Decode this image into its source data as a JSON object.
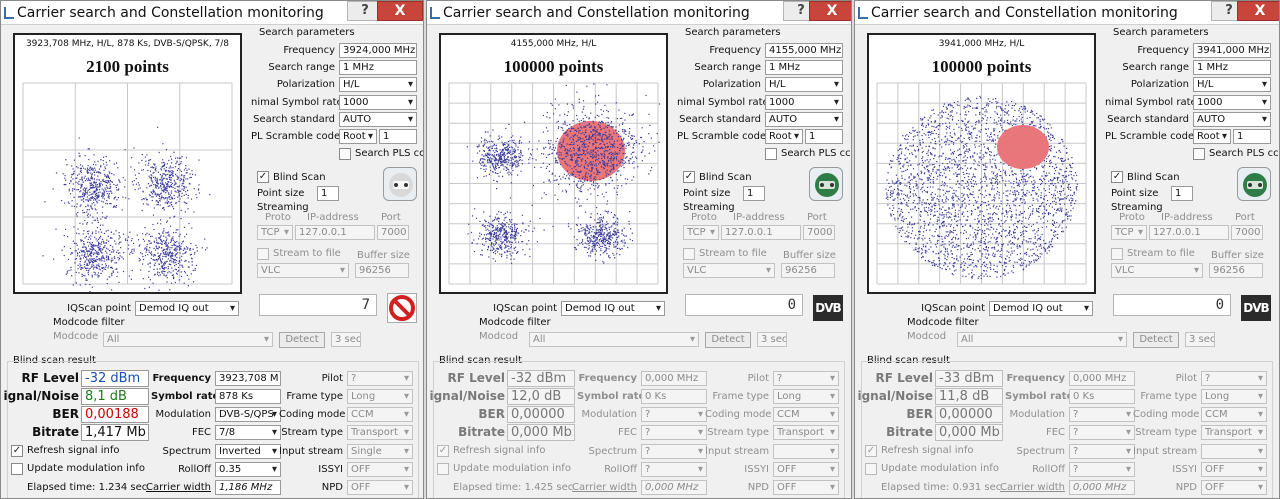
{
  "windows": [
    {
      "title": "Carrier search and Constellation monitoring",
      "help_label": "?",
      "close_label": "X",
      "constellation": {
        "header": "3923,708 MHz, H/L, 878 Ks, DVB-S/QPSK, 7/8",
        "points_text": "2100 points",
        "mode": "qpsk_sparse"
      },
      "search_params": {
        "title": "Search parameters",
        "frequency_label": "Frequency",
        "frequency": "3924,000 MHz",
        "search_range_label": "Search range",
        "search_range": "1 MHz",
        "polarization_label": "Polarization",
        "polarization": "H/L",
        "min_symbol_rate_label": "nimal Symbol rate",
        "min_symbol_rate": "1000",
        "search_standard_label": "Search standard",
        "search_standard": "AUTO",
        "pl_scramble_label": "PL Scramble code",
        "pl_scramble_mode": "Root",
        "pl_scramble_value": "1",
        "search_pls_label": "Search PLS cc"
      },
      "blind_scan_label": "Blind Scan",
      "point_size_label": "Point size",
      "point_size": "1",
      "streaming": {
        "title": "Streaming",
        "proto_label": "Proto",
        "ip_label": "IP-address",
        "port_label": "Port",
        "proto": "TCP",
        "ip": "127.0.0.1",
        "port": "7000",
        "stream_to_file_label": "Stream to file",
        "buffer_size_label": "Buffer size",
        "player": "VLC",
        "buffer_size": "96256"
      },
      "iqscan_label": "IQScan point",
      "iqscan": "Demod IQ out",
      "modcode_filter_label": "Modcode filter",
      "modcode_label": "Modcode",
      "modcode": "All",
      "detect_label": "Detect",
      "detect_time": "3 sec",
      "lcd_value": "7",
      "right_icon": "no-entry-icon",
      "result": {
        "title": "Blind scan result",
        "rf_level_label": "RF Level",
        "rf_level": "-32 dBm",
        "snr_label": "ignal/Noise",
        "snr": "8,1 dB",
        "ber_label": "BER",
        "ber": "0,00188",
        "bitrate_label": "Bitrate",
        "bitrate": "1,417 Mb",
        "refresh_label": "Refresh signal info",
        "update_mod_label": "Update modulation info",
        "elapsed": "Elapsed time: 1.234 sec",
        "frequency_label": "Frequency",
        "frequency": "3923,708 M",
        "symbol_rate_label": "Symbol rate",
        "symbol_rate": "878 Ks",
        "modulation_label": "Modulation",
        "modulation": "DVB-S/QPS",
        "fec_label": "FEC",
        "fec": "7/8",
        "spectrum_label": "Spectrum",
        "spectrum": "Inverted",
        "rolloff_label": "RollOff",
        "rolloff": "0.35",
        "carrier_width_label": "Carrier width",
        "carrier_width": "1,186 MHz",
        "pilot_label": "Pilot",
        "pilot": "?",
        "frame_type_label": "Frame type",
        "frame_type": "Long",
        "coding_mode_label": "Coding mode",
        "coding_mode": "CCM",
        "stream_type_label": "Stream type",
        "stream_type": "Transport",
        "input_stream_label": "Input stream",
        "input_stream": "Single",
        "issyi_label": "ISSYI",
        "issyi": "OFF",
        "npd_label": "NPD",
        "npd": "OFF"
      }
    },
    {
      "title": "Carrier search and Constellation monitoring",
      "help_label": "?",
      "close_label": "X",
      "constellation": {
        "header": "4155,000 MHz, H/L",
        "points_text": "100000 points",
        "mode": "hot_top_right"
      },
      "search_params": {
        "title": "Search parameters",
        "frequency_label": "Frequency",
        "frequency": "4155,000 MHz",
        "search_range_label": "Search range",
        "search_range": "1 MHz",
        "polarization_label": "Polarization",
        "polarization": "H/L",
        "min_symbol_rate_label": "nimal Symbol rate",
        "min_symbol_rate": "1000",
        "search_standard_label": "Search standard",
        "search_standard": "AUTO",
        "pl_scramble_label": "PL Scramble code",
        "pl_scramble_mode": "Root",
        "pl_scramble_value": "1",
        "search_pls_label": "Search PLS cc"
      },
      "blind_scan_label": "Blind Scan",
      "point_size_label": "Point size",
      "point_size": "1",
      "streaming": {
        "title": "Streaming",
        "proto_label": "Proto",
        "ip_label": "IP-address",
        "port_label": "Port",
        "proto": "TCP",
        "ip": "127.0.0.1",
        "port": "7000",
        "stream_to_file_label": "Stream to file",
        "buffer_size_label": "Buffer size",
        "player": "VLC",
        "buffer_size": "96256"
      },
      "iqscan_label": "IQScan point",
      "iqscan": "Demod IQ out",
      "modcode_filter_label": "Modcode filter",
      "modcode_label": "Modcod",
      "modcode": "All",
      "detect_label": "Detect",
      "detect_time": "3 sec",
      "lcd_value": "0",
      "right_icon": "dvb-logo-icon",
      "dvb_text": "DVB",
      "result": {
        "title": "Blind scan result",
        "rf_level_label": "RF Level",
        "rf_level": "-32 dBm",
        "snr_label": "ignal/Noise",
        "snr": "12,0 dB",
        "ber_label": "BER",
        "ber": "0,00000",
        "bitrate_label": "Bitrate",
        "bitrate": "0,000 Mb",
        "refresh_label": "Refresh signal info",
        "update_mod_label": "Update modulation info",
        "elapsed": "Elapsed time: 1.425 sec",
        "frequency_label": "Frequency",
        "frequency": "0,000 MHz",
        "symbol_rate_label": "Symbol rate",
        "symbol_rate": "0 Ks",
        "modulation_label": "Modulation",
        "modulation": "?",
        "fec_label": "FEC",
        "fec": "?",
        "spectrum_label": "Spectrum",
        "spectrum": "?",
        "rolloff_label": "RollOff",
        "rolloff": "?",
        "carrier_width_label": "Carrier width",
        "carrier_width": "0,000 MHz",
        "pilot_label": "Pilot",
        "pilot": "?",
        "frame_type_label": "Frame type",
        "frame_type": "Long",
        "coding_mode_label": "Coding mode",
        "coding_mode": "CCM",
        "stream_type_label": "Stream type",
        "stream_type": "Transport",
        "input_stream_label": "Input stream",
        "input_stream": "",
        "issyi_label": "ISSYI",
        "issyi": "OFF",
        "npd_label": "NPD",
        "npd": "OFF"
      }
    },
    {
      "title": "Carrier search and Constellation monitoring",
      "help_label": "?",
      "close_label": "X",
      "constellation": {
        "header": "3941,000 MHz, H/L",
        "points_text": "100000 points",
        "mode": "blob"
      },
      "search_params": {
        "title": "Search parameters",
        "frequency_label": "Frequency",
        "frequency": "3941,000 MHz",
        "search_range_label": "Search range",
        "search_range": "1 MHz",
        "polarization_label": "Polarization",
        "polarization": "H/L",
        "min_symbol_rate_label": "nimal Symbol rate",
        "min_symbol_rate": "1000",
        "search_standard_label": "Search standard",
        "search_standard": "AUTO",
        "pl_scramble_label": "PL Scramble code",
        "pl_scramble_mode": "Root",
        "pl_scramble_value": "1",
        "search_pls_label": "Search PLS cc"
      },
      "blind_scan_label": "Blind Scan",
      "point_size_label": "Point size",
      "point_size": "1",
      "streaming": {
        "title": "Streaming",
        "proto_label": "Proto",
        "ip_label": "IP-address",
        "port_label": "Port",
        "proto": "TCP",
        "ip": "127.0.0.1",
        "port": "7000",
        "stream_to_file_label": "Stream to file",
        "buffer_size_label": "Buffer size",
        "player": "VLC",
        "buffer_size": "96256"
      },
      "iqscan_label": "IQScan point",
      "iqscan": "Demod IQ out",
      "modcode_filter_label": "Modcode filter",
      "modcode_label": "Modcod",
      "modcode": "All",
      "detect_label": "Detect",
      "detect_time": "3 sec",
      "lcd_value": "0",
      "right_icon": "dvb-logo-icon",
      "dvb_text": "DVB",
      "result": {
        "title": "Blind scan result",
        "rf_level_label": "RF Level",
        "rf_level": "-33 dBm",
        "snr_label": "ignal/Noise",
        "snr": "11,8 dB",
        "ber_label": "BER",
        "ber": "0,00000",
        "bitrate_label": "Bitrate",
        "bitrate": "0,000 Mb",
        "refresh_label": "Refresh signal info",
        "update_mod_label": "Update modulation info",
        "elapsed": "Elapsed time: 0.931 sec",
        "frequency_label": "Frequency",
        "frequency": "0,000 MHz",
        "symbol_rate_label": "Symbol rate",
        "symbol_rate": "0 Ks",
        "modulation_label": "Modulation",
        "modulation": "?",
        "fec_label": "FEC",
        "fec": "?",
        "spectrum_label": "Spectrum",
        "spectrum": "?",
        "rolloff_label": "RollOff",
        "rolloff": "?",
        "carrier_width_label": "Carrier width",
        "carrier_width": "0,000 MHz",
        "pilot_label": "Pilot",
        "pilot": "?",
        "frame_type_label": "Frame type",
        "frame_type": "Long",
        "coding_mode_label": "Coding mode",
        "coding_mode": "CCM",
        "stream_type_label": "Stream type",
        "stream_type": "Transport",
        "input_stream_label": "Input stream",
        "input_stream": "",
        "issyi_label": "ISSYI",
        "issyi": "OFF",
        "npd_label": "NPD",
        "npd": "OFF"
      }
    }
  ],
  "colors": {
    "point_color": "#3a3a9a",
    "hot_color": "#e8767a",
    "ber_active": "#cc0000",
    "snr_active": "#1e7a1e",
    "rf_active": "#1a4fb0",
    "close_red": "#c8453b"
  }
}
